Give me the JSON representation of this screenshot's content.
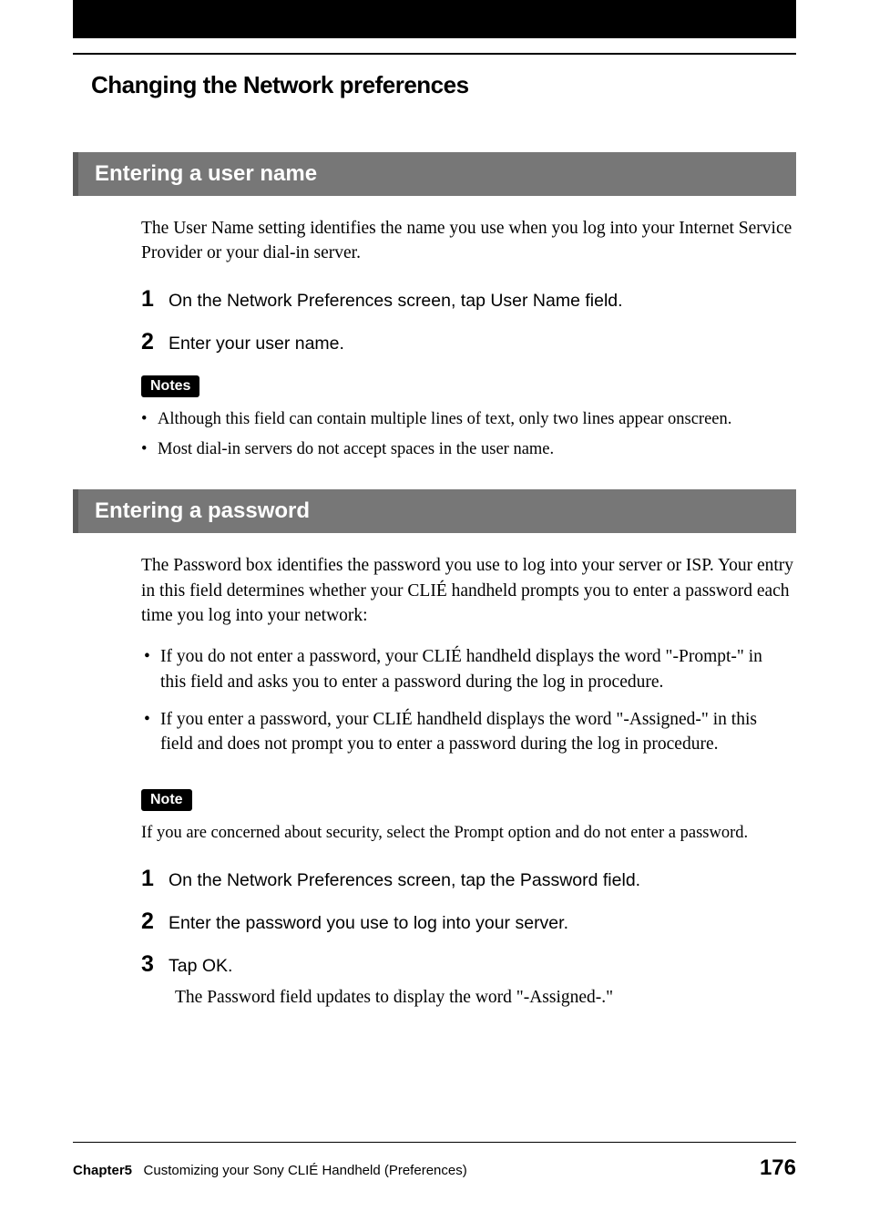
{
  "title": "Changing the Network preferences",
  "sections": [
    {
      "header": "Entering a user name",
      "intro": "The User Name setting identifies the name you use when you log into your Internet Service Provider or your dial-in server.",
      "steps": [
        "On the Network Preferences screen, tap User Name field.",
        "Enter your user name."
      ],
      "notes_label": "Notes",
      "notes": [
        "Although this field can contain multiple lines of text, only two lines appear onscreen.",
        "Most dial-in servers do not accept spaces in the user name."
      ]
    },
    {
      "header": "Entering a password",
      "intro": "The Password box identifies the password you use to log into your server or ISP. Your entry in this field determines whether your CLIÉ handheld prompts you to enter a password each time you log into your network:",
      "bullets": [
        "If you do not enter a password, your CLIÉ handheld displays the word \"-Prompt-\" in this field and asks you to enter a password during the log in procedure.",
        "If you enter a password, your CLIÉ handheld displays the word  \"-Assigned-\" in this field and does not prompt you to enter a password during the log in procedure."
      ],
      "note_label": "Note",
      "note_text": "If you are concerned about security, select the Prompt option and do not enter a password.",
      "steps2": [
        {
          "text": "On the Network Preferences screen, tap the Password field."
        },
        {
          "text": "Enter the password you use to log into your server."
        },
        {
          "text": " Tap OK.",
          "sub": "The Password field updates to display the word \"-Assigned-.\""
        }
      ]
    }
  ],
  "footer": {
    "chapter_label": "Chapter5",
    "chapter_text": "Customizing your Sony CLIÉ Handheld (Preferences)",
    "page": "176"
  }
}
